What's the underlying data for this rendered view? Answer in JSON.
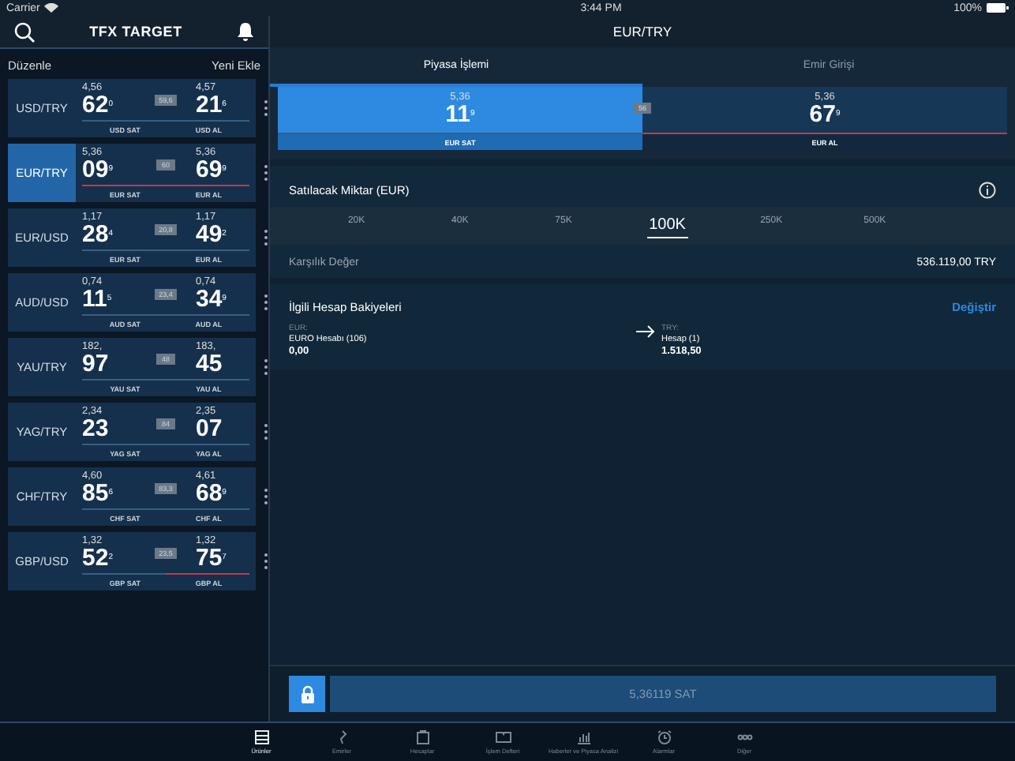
{
  "status_bar": {
    "carrier": "Carrier",
    "time": "3:44 PM",
    "battery": "100%"
  },
  "sidebar": {
    "title": "TFX TARGET",
    "edit": "Düzenle",
    "add": "Yeni Ekle",
    "pairs": [
      {
        "name": "USD/TRY",
        "selected": false,
        "sell_prefix": "4,56",
        "sell_big": "62",
        "sell_sup": "0",
        "spread": "59,6",
        "buy_prefix": "4,57",
        "buy_big": "21",
        "buy_sup": "6",
        "sell_label": "USD SAT",
        "buy_label": "USD AL",
        "sell_alert": false,
        "buy_alert": false
      },
      {
        "name": "EUR/TRY",
        "selected": true,
        "sell_prefix": "5,36",
        "sell_big": "09",
        "sell_sup": "9",
        "spread": "60",
        "buy_prefix": "5,36",
        "buy_big": "69",
        "buy_sup": "9",
        "sell_label": "EUR SAT",
        "buy_label": "EUR AL",
        "sell_alert": true,
        "buy_alert": true
      },
      {
        "name": "EUR/USD",
        "selected": false,
        "sell_prefix": "1,17",
        "sell_big": "28",
        "sell_sup": "4",
        "spread": "20,8",
        "buy_prefix": "1,17",
        "buy_big": "49",
        "buy_sup": "2",
        "sell_label": "EUR SAT",
        "buy_label": "EUR AL",
        "sell_alert": false,
        "buy_alert": false
      },
      {
        "name": "AUD/USD",
        "selected": false,
        "sell_prefix": "0,74",
        "sell_big": "11",
        "sell_sup": "5",
        "spread": "23,4",
        "buy_prefix": "0,74",
        "buy_big": "34",
        "buy_sup": "9",
        "sell_label": "AUD SAT",
        "buy_label": "AUD AL",
        "sell_alert": false,
        "buy_alert": false
      },
      {
        "name": "YAU/TRY",
        "selected": false,
        "sell_prefix": "182,",
        "sell_big": "97",
        "spread": "48",
        "buy_prefix": "183,",
        "buy_big": "45",
        "sell_label": "YAU SAT",
        "buy_label": "YAU AL",
        "sell_alert": false,
        "buy_alert": false
      },
      {
        "name": "YAG/TRY",
        "selected": false,
        "sell_prefix": "2,34",
        "sell_big": "23",
        "spread": "84",
        "buy_prefix": "2,35",
        "buy_big": "07",
        "sell_label": "YAG SAT",
        "buy_label": "YAG AL",
        "sell_alert": false,
        "buy_alert": false
      },
      {
        "name": "CHF/TRY",
        "selected": false,
        "sell_prefix": "4,60",
        "sell_big": "85",
        "sell_sup": "6",
        "spread": "83,3",
        "buy_prefix": "4,61",
        "buy_big": "68",
        "buy_sup": "9",
        "sell_label": "CHF SAT",
        "buy_label": "CHF AL",
        "sell_alert": false,
        "buy_alert": false
      },
      {
        "name": "GBP/USD",
        "selected": false,
        "sell_prefix": "1,32",
        "sell_big": "52",
        "sell_sup": "2",
        "spread": "23,5",
        "buy_prefix": "1,32",
        "buy_big": "75",
        "buy_sup": "7",
        "sell_label": "GBP SAT",
        "buy_label": "GBP AL",
        "sell_alert": false,
        "buy_alert": true
      }
    ]
  },
  "detail": {
    "title": "EUR/TRY",
    "tabs": [
      {
        "label": "Piyasa İşlemi",
        "selected": true
      },
      {
        "label": "Emir Girişi",
        "selected": false
      }
    ],
    "quote": {
      "sell_prefix": "5,36",
      "sell_big": "11",
      "sell_sup": "9",
      "spread": "56",
      "buy_prefix": "5,36",
      "buy_big": "67",
      "buy_sup": "9",
      "sell_label": "EUR SAT",
      "buy_label": "EUR AL",
      "sell_selected": true,
      "buy_alert": true
    },
    "amount_label": "Satılacak Miktar (EUR)",
    "amounts": [
      {
        "label": "20K",
        "selected": false
      },
      {
        "label": "40K",
        "selected": false
      },
      {
        "label": "75K",
        "selected": false
      },
      {
        "label": "100K",
        "selected": true
      },
      {
        "label": "250K",
        "selected": false
      },
      {
        "label": "500K",
        "selected": false
      }
    ],
    "equivalent_label": "Karşılık Değer",
    "equivalent_value": "536.119,00 TRY",
    "balances_title": "İlgili Hesap Bakiyeleri",
    "change": "Değiştir",
    "from": {
      "currency": "EUR:",
      "account": "EURO Hesabı (106)",
      "amount": "0,00"
    },
    "to": {
      "currency": "TRY:",
      "account": "Hesap (1)",
      "amount": "1.518,50"
    },
    "action": "5,36119 SAT"
  },
  "tab_bar": [
    {
      "label": "Ürünler",
      "selected": true
    },
    {
      "label": "Emirler",
      "selected": false
    },
    {
      "label": "Hesaplar",
      "selected": false
    },
    {
      "label": "İşlem Defteri",
      "selected": false
    },
    {
      "label": "Haberler ve Piyasa Analizi",
      "selected": false
    },
    {
      "label": "Alarmlar",
      "selected": false
    },
    {
      "label": "Diğer",
      "selected": false
    }
  ]
}
